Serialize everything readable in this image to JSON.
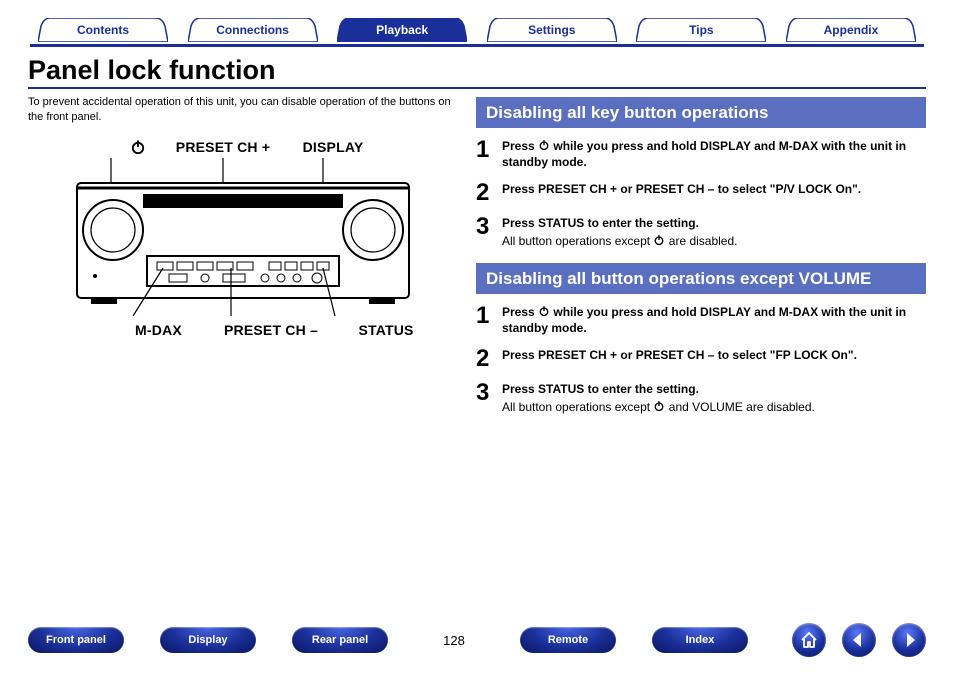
{
  "tabs": [
    "Contents",
    "Connections",
    "Playback",
    "Settings",
    "Tips",
    "Appendix"
  ],
  "active_tab": 2,
  "title": "Panel lock function",
  "intro": "To prevent accidental operation of this unit, you can disable operation of the buttons on the front panel.",
  "diagram": {
    "top_labels": [
      "⏻",
      "PRESET CH +",
      "DISPLAY"
    ],
    "bottom_labels": [
      "M-DAX",
      "PRESET CH –",
      "STATUS"
    ]
  },
  "sections": [
    {
      "heading": "Disabling all key button operations",
      "steps": [
        {
          "main": "Press ⏻ while you press and hold DISPLAY and M-DAX with the unit in standby mode."
        },
        {
          "main": "Press PRESET CH + or PRESET CH – to select \"P/V LOCK On\"."
        },
        {
          "main": "Press STATUS to enter the setting.",
          "sub": "All button operations except ⏻ are disabled."
        }
      ]
    },
    {
      "heading": "Disabling all button operations except VOLUME",
      "steps": [
        {
          "main": "Press ⏻ while you press and hold DISPLAY and M-DAX with the unit in standby mode."
        },
        {
          "main": "Press PRESET CH + or PRESET CH – to select \"FP LOCK On\"."
        },
        {
          "main": "Press STATUS to enter the setting.",
          "sub": "All button operations except ⏻ and VOLUME are disabled."
        }
      ]
    }
  ],
  "bottom_nav": {
    "pills": [
      "Front panel",
      "Display",
      "Rear panel"
    ],
    "page": "128",
    "pills_right": [
      "Remote",
      "Index"
    ],
    "icons": [
      "home-icon",
      "back-icon",
      "forward-icon"
    ]
  }
}
